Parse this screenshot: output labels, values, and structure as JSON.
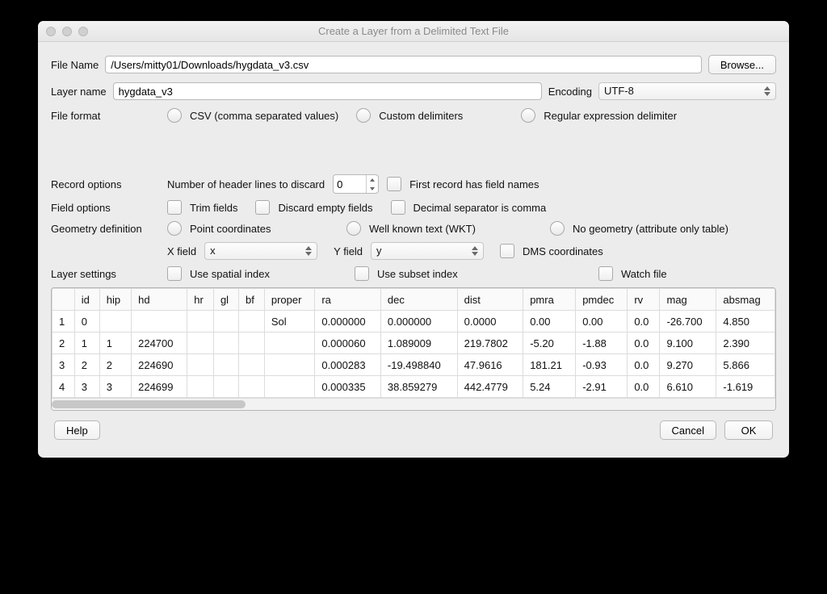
{
  "window": {
    "title": "Create a Layer from a Delimited Text File"
  },
  "fileName": {
    "label": "File Name",
    "value": "/Users/mitty01/Downloads/hygdata_v3.csv",
    "browse": "Browse..."
  },
  "layerName": {
    "label": "Layer name",
    "value": "hygdata_v3"
  },
  "encoding": {
    "label": "Encoding",
    "value": "UTF-8"
  },
  "fileFormat": {
    "label": "File format",
    "csv": "CSV (comma separated values)",
    "custom": "Custom delimiters",
    "regex": "Regular expression delimiter"
  },
  "recordOptions": {
    "label": "Record options",
    "discardLabel": "Number of header lines to discard",
    "discardValue": "0",
    "firstRecord": "First record has field names"
  },
  "fieldOptions": {
    "label": "Field options",
    "trim": "Trim fields",
    "discardEmpty": "Discard empty fields",
    "decimalComma": "Decimal separator is comma"
  },
  "geometry": {
    "label": "Geometry definition",
    "point": "Point coordinates",
    "wkt": "Well known text (WKT)",
    "noGeom": "No geometry (attribute only table)",
    "xfieldLabel": "X field",
    "xfield": "x",
    "yfieldLabel": "Y field",
    "yfield": "y",
    "dms": "DMS coordinates"
  },
  "layerSettings": {
    "label": "Layer settings",
    "spatialIndex": "Use spatial index",
    "subsetIndex": "Use subset index",
    "watch": "Watch file"
  },
  "columns": [
    "",
    "id",
    "hip",
    "hd",
    "hr",
    "gl",
    "bf",
    "proper",
    "ra",
    "dec",
    "dist",
    "pmra",
    "pmdec",
    "rv",
    "mag",
    "absmag"
  ],
  "rows": [
    [
      "1",
      "0",
      "",
      "",
      "",
      "",
      "",
      "Sol",
      "0.000000",
      "0.000000",
      "0.0000",
      "0.00",
      "0.00",
      "0.0",
      "-26.700",
      "4.850"
    ],
    [
      "2",
      "1",
      "1",
      "224700",
      "",
      "",
      "",
      "",
      "0.000060",
      "1.089009",
      "219.7802",
      "-5.20",
      "-1.88",
      "0.0",
      "9.100",
      "2.390"
    ],
    [
      "3",
      "2",
      "2",
      "224690",
      "",
      "",
      "",
      "",
      "0.000283",
      "-19.498840",
      "47.9616",
      "181.21",
      "-0.93",
      "0.0",
      "9.270",
      "5.866"
    ],
    [
      "4",
      "3",
      "3",
      "224699",
      "",
      "",
      "",
      "",
      "0.000335",
      "38.859279",
      "442.4779",
      "5.24",
      "-2.91",
      "0.0",
      "6.610",
      "-1.619"
    ]
  ],
  "footer": {
    "help": "Help",
    "cancel": "Cancel",
    "ok": "OK"
  }
}
